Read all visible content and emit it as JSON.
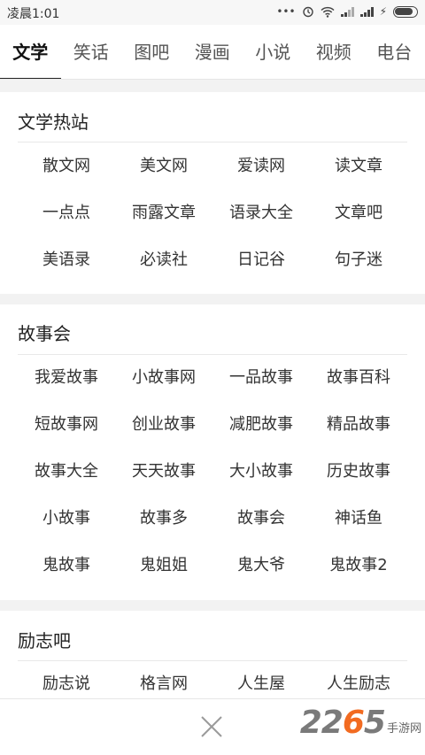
{
  "status_bar": {
    "time": "凌晨1:01",
    "battery_level": 0.85
  },
  "tabs": [
    {
      "label": "文学",
      "active": true
    },
    {
      "label": "笑话",
      "active": false
    },
    {
      "label": "图吧",
      "active": false
    },
    {
      "label": "漫画",
      "active": false
    },
    {
      "label": "小说",
      "active": false
    },
    {
      "label": "视频",
      "active": false
    },
    {
      "label": "电台",
      "active": false
    }
  ],
  "sections": [
    {
      "title": "文学热站",
      "items": [
        "散文网",
        "美文网",
        "爱读网",
        "读文章",
        "一点点",
        "雨露文章",
        "语录大全",
        "文章吧",
        "美语录",
        "必读社",
        "日记谷",
        "句子迷"
      ]
    },
    {
      "title": "故事会",
      "items": [
        "我爱故事",
        "小故事网",
        "一品故事",
        "故事百科",
        "短故事网",
        "创业故事",
        "减肥故事",
        "精品故事",
        "故事大全",
        "天天故事",
        "大小故事",
        "历史故事",
        "小故事",
        "故事多",
        "故事会",
        "神话鱼",
        "鬼故事",
        "鬼姐姐",
        "鬼大爷",
        "鬼故事2"
      ]
    },
    {
      "title": "励志吧",
      "items": [
        "励志说",
        "格言网",
        "人生屋",
        "人生励志"
      ]
    }
  ],
  "watermark": {
    "number_prefix": "22",
    "number_accent": "6",
    "number_suffix": "5",
    "site": "手游网"
  }
}
